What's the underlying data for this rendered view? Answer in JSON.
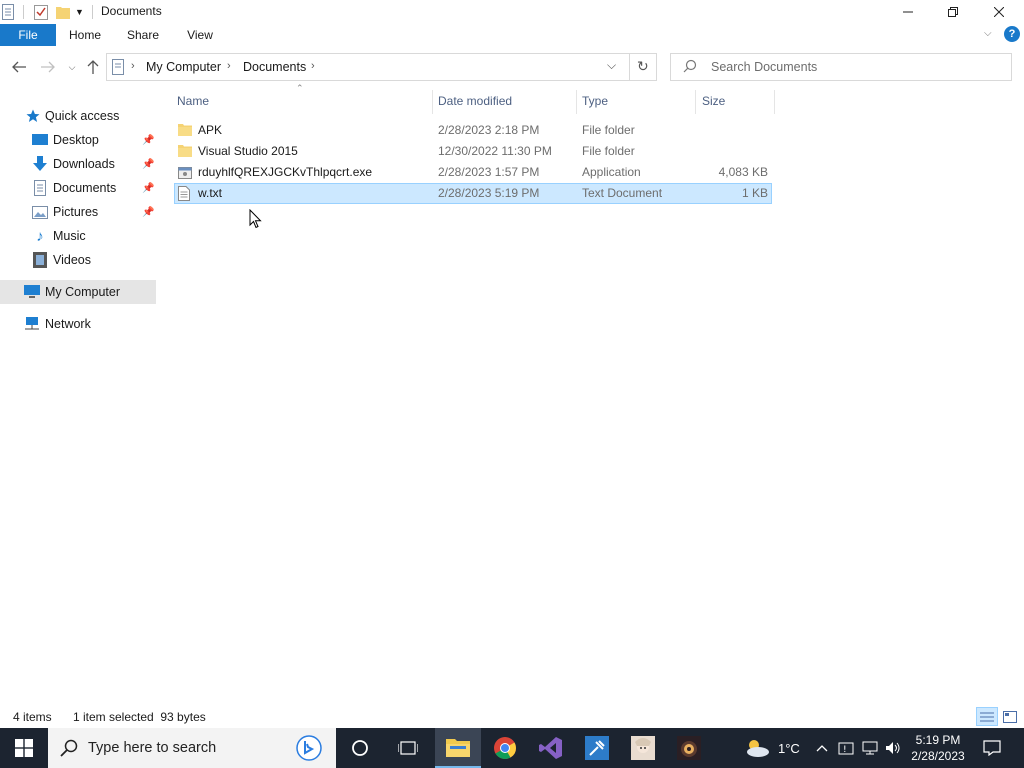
{
  "window": {
    "title": "Documents"
  },
  "ribbon": {
    "tabs": [
      "File",
      "Home",
      "Share",
      "View"
    ]
  },
  "address": {
    "crumbs": [
      "My Computer",
      "Documents"
    ]
  },
  "search": {
    "placeholder": "Search Documents"
  },
  "sidebar": {
    "items": [
      {
        "label": "Quick access",
        "icon": "star-icon"
      },
      {
        "label": "Desktop",
        "icon": "desktop-icon",
        "pinned": true
      },
      {
        "label": "Downloads",
        "icon": "download-icon",
        "pinned": true
      },
      {
        "label": "Documents",
        "icon": "documents-icon",
        "pinned": true
      },
      {
        "label": "Pictures",
        "icon": "pictures-icon",
        "pinned": true
      },
      {
        "label": "Music",
        "icon": "music-icon"
      },
      {
        "label": "Videos",
        "icon": "videos-icon"
      },
      {
        "label": "My Computer",
        "icon": "computer-icon",
        "selected": true
      },
      {
        "label": "Network",
        "icon": "network-icon"
      }
    ]
  },
  "columns": {
    "name": "Name",
    "date": "Date modified",
    "type": "Type",
    "size": "Size"
  },
  "files": [
    {
      "name": "APK",
      "date": "2/28/2023 2:18 PM",
      "type": "File folder",
      "size": "",
      "icon": "folder-icon"
    },
    {
      "name": "Visual Studio 2015",
      "date": "12/30/2022 11:30 PM",
      "type": "File folder",
      "size": "",
      "icon": "folder-icon"
    },
    {
      "name": "rduyhlfQREXJGCKvThlpqcrt.exe",
      "date": "2/28/2023 1:57 PM",
      "type": "Application",
      "size": "4,083 KB",
      "icon": "exe-icon"
    },
    {
      "name": "w.txt",
      "date": "2/28/2023 5:19 PM",
      "type": "Text Document",
      "size": "1 KB",
      "icon": "text-file-icon",
      "selected": true
    }
  ],
  "status": {
    "items": "4 items",
    "selection": "1 item selected  93 bytes"
  },
  "taskbar": {
    "search_placeholder": "Type here to search",
    "weather": "1°C",
    "time": "5:19 PM",
    "date": "2/28/2023"
  },
  "colors": {
    "accent": "#1979ca",
    "selection_bg": "#cce8ff",
    "selection_border": "#99d1ff",
    "taskbar": "#1c2430"
  }
}
